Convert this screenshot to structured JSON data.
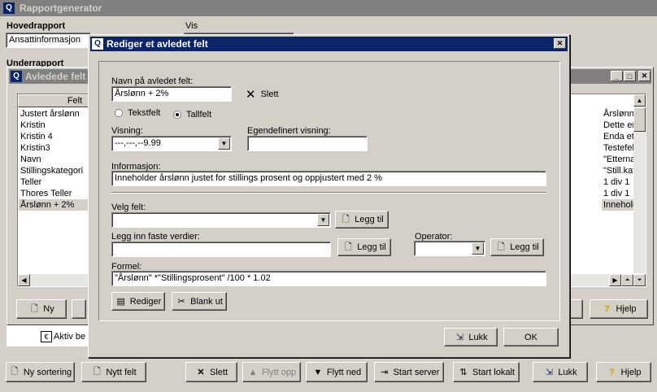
{
  "main_window": {
    "title": "Rapportgenerator",
    "hovedrapport_label": "Hovedrapport",
    "hovedrapport_value": "Ansattinformasjon",
    "vis_label": "Vis",
    "underrapport_label": "Underrapport",
    "tree_items": [
      "Aktiv be"
    ],
    "bottom_buttons": [
      "Ny sortering",
      "Nytt felt",
      "Slett",
      "Flytt opp",
      "Flytt ned",
      "Start server",
      "Start lokalt",
      "Lukk",
      "Hjelp"
    ]
  },
  "avledede_window": {
    "title": "Avledede felt",
    "col_felt": "Felt",
    "left_rows": [
      "Justert årslønn",
      "Kristin",
      "Kristin 4",
      "Kristin3",
      "Navn",
      "Stillingskategori",
      "Teller",
      "Thores Teller",
      "Årslønn + 2%"
    ],
    "right_rows": [
      "Årslønn b",
      "Dette er e",
      "Enda et lu",
      "Testefelt f",
      "\"Etternavn",
      "\"Still.kat/å",
      "1 div 1",
      "1 div 1",
      "Inneholder"
    ],
    "ny_button": "Ny",
    "hjelp_button": "Hjelp"
  },
  "dialog": {
    "title": "Rediger et avledet felt",
    "navn_label": "Navn på avledet felt:",
    "navn_value": "Årslønn + 2%",
    "slett_label": "Slett",
    "tekstfelt_label": "Tekstfelt",
    "tallfelt_label": "Tallfelt",
    "visning_label": "Visning:",
    "visning_value": "---,---,--9.99",
    "egendefinert_label": "Egendefinert visning:",
    "egendefinert_value": "",
    "informasjon_label": "Informasjon:",
    "informasjon_value": "Inneholder årslønn justet for stillings prosent og oppjustert med 2 %",
    "velg_felt_label": "Velg felt:",
    "velg_felt_value": "",
    "legg_til_label": "Legg til",
    "faste_label": "Legg inn faste verdier:",
    "faste_value": "",
    "operator_label": "Operator:",
    "operator_value": "",
    "formel_label": "Formel:",
    "formel_value": "\"Årslønn\"  *\"Stillingsprosent\" /100 * 1.02",
    "rediger_label": "Rediger",
    "blank_ut_label": "Blank ut",
    "lukk_label": "Lukk",
    "ok_label": "OK"
  }
}
